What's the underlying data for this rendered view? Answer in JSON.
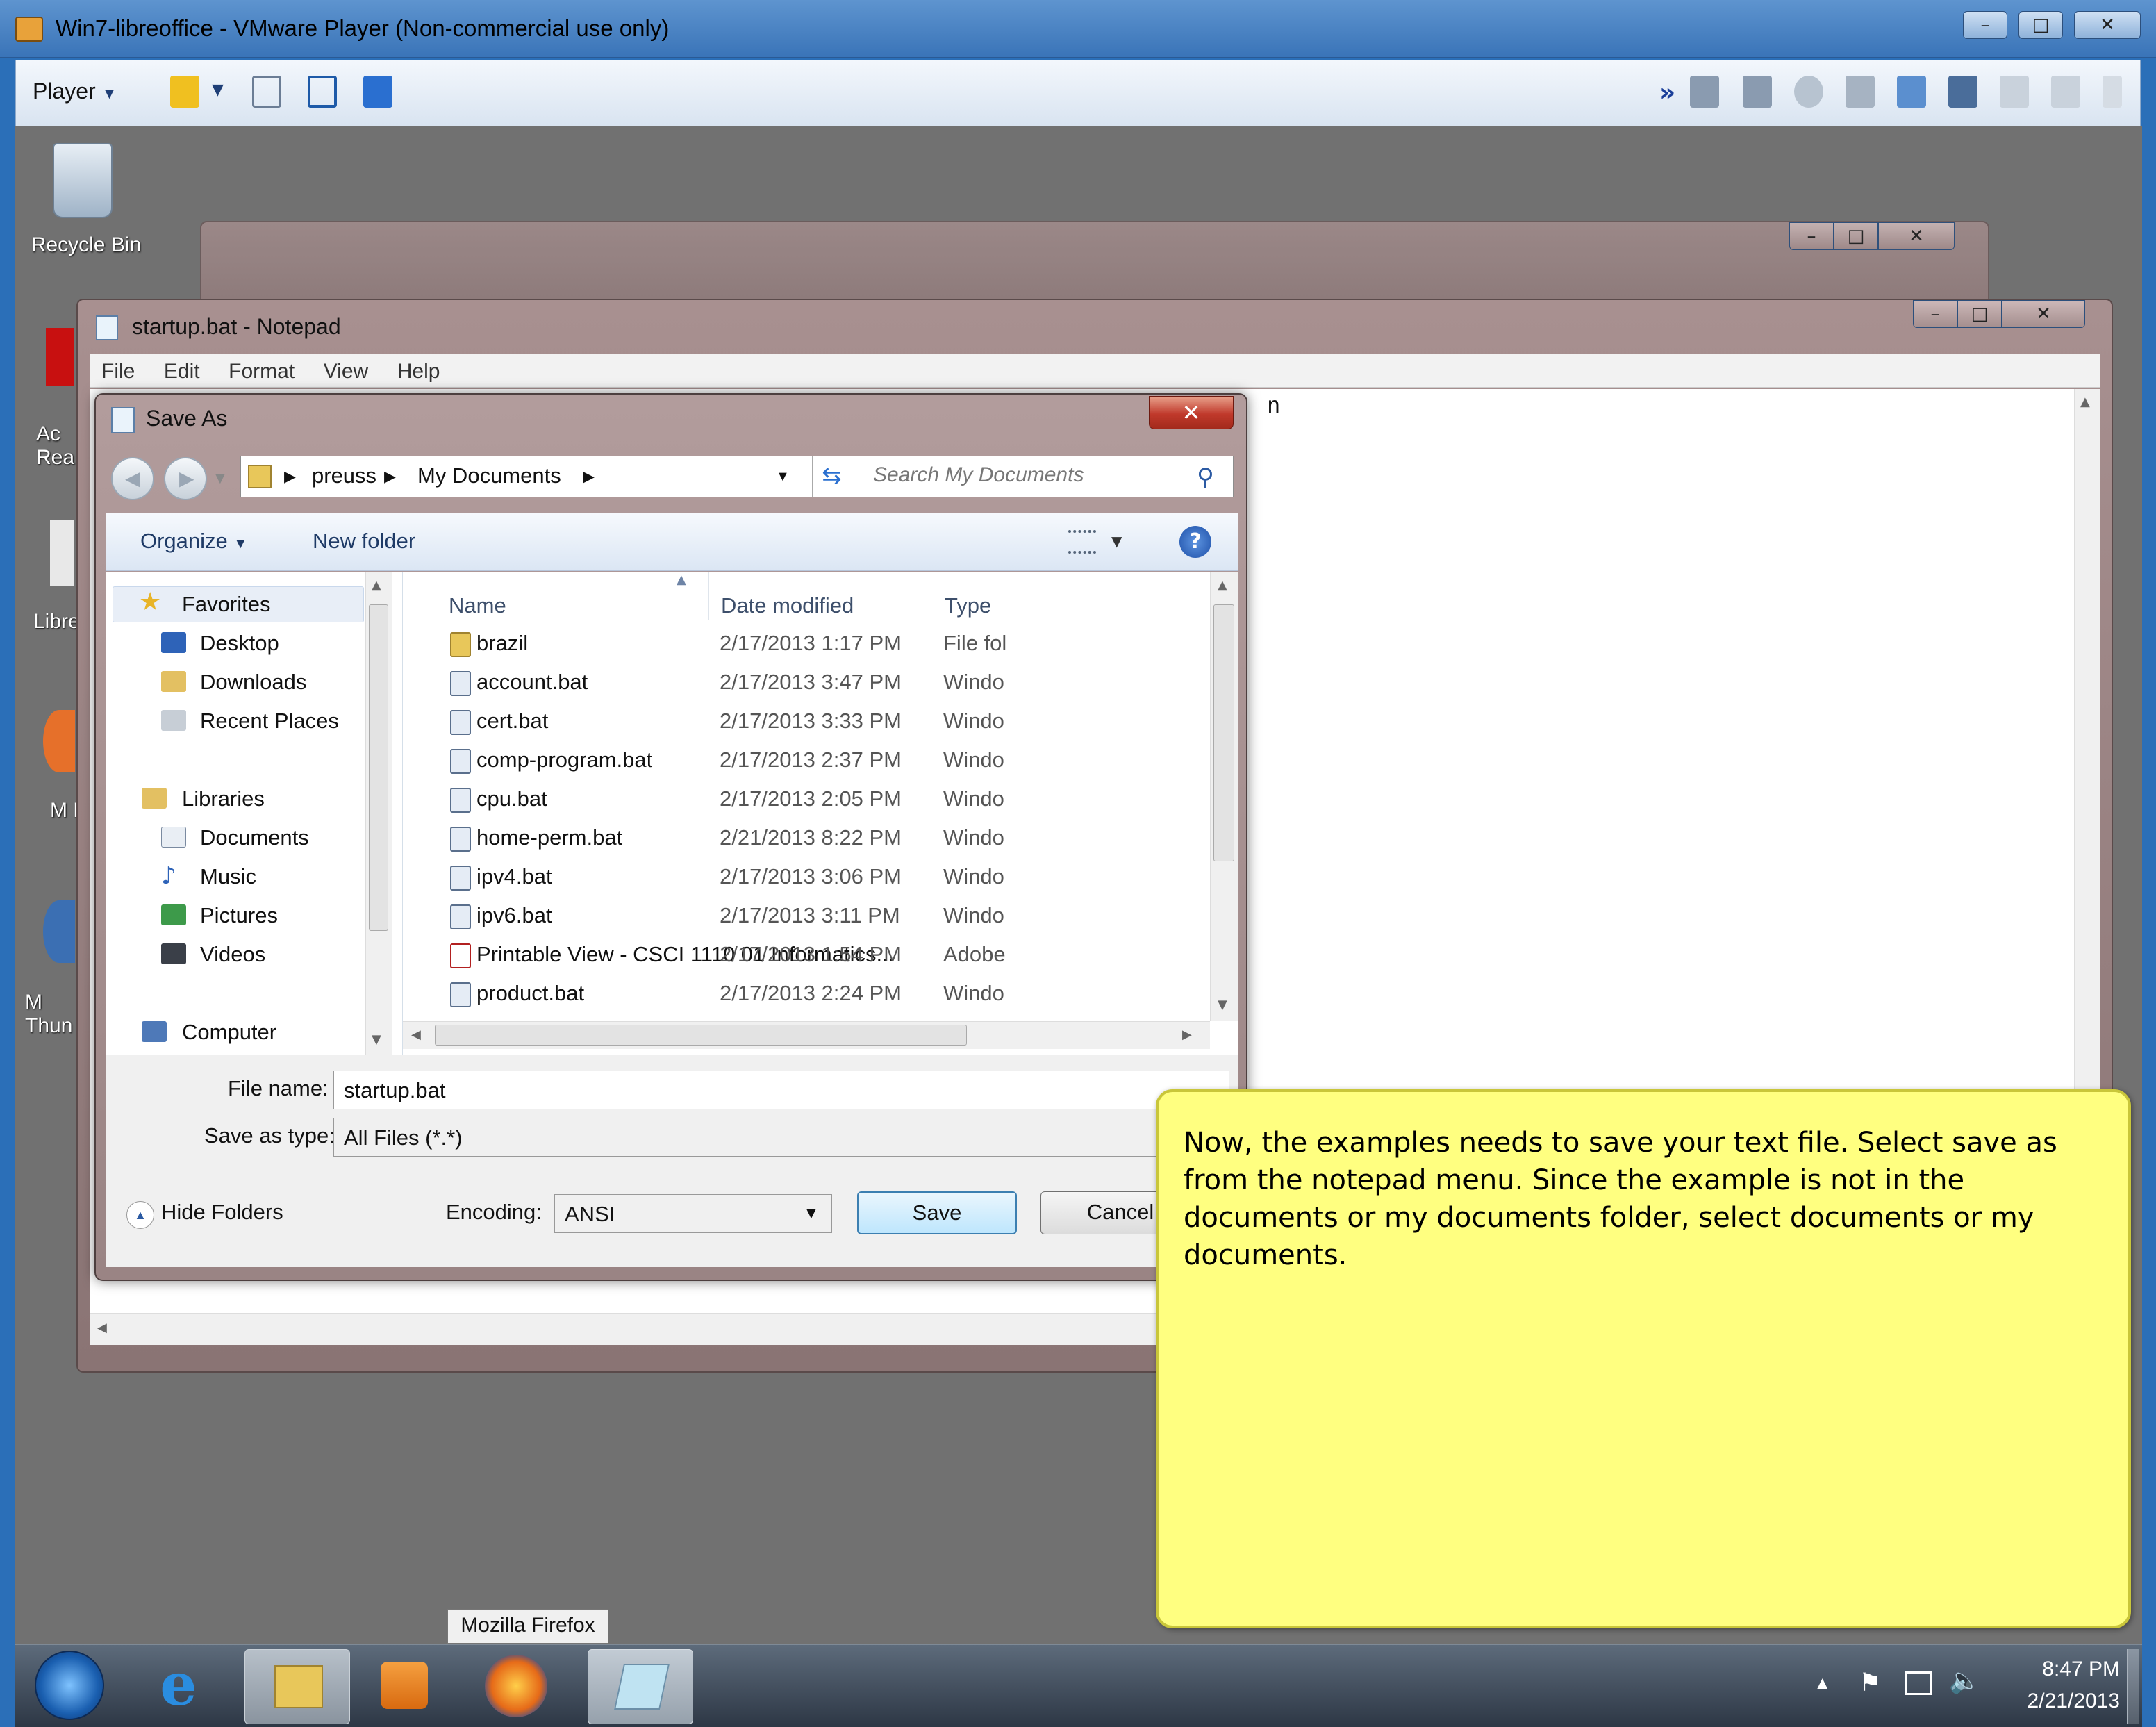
{
  "vm": {
    "title": "Win7-libreoffice - VMware Player (Non-commercial use only)",
    "player_menu": "Player"
  },
  "desktop": {
    "icons": [
      {
        "label": "Recycle Bin",
        "icon": "recycle-bin-icon"
      },
      {
        "label": "Ac Rea",
        "icon": "acrobat-reader-icon"
      },
      {
        "label": "Libre",
        "icon": "libreoffice-icon"
      },
      {
        "label": "M Fi",
        "icon": "firefox-icon"
      },
      {
        "label": "M Thun",
        "icon": "thunderbird-icon"
      }
    ]
  },
  "notepad": {
    "title": "startup.bat - Notepad",
    "menu": [
      "File",
      "Edit",
      "Format",
      "View",
      "Help"
    ],
    "visible_text": "n"
  },
  "saveas": {
    "title": "Save As",
    "breadcrumb": [
      "preuss",
      "My Documents"
    ],
    "search_placeholder": "Search My Documents",
    "organize": "Organize",
    "new_folder": "New folder",
    "nav": {
      "favorites": "Favorites",
      "favorites_items": [
        "Desktop",
        "Downloads",
        "Recent Places"
      ],
      "libraries": "Libraries",
      "libraries_items": [
        "Documents",
        "Music",
        "Pictures",
        "Videos"
      ],
      "computer": "Computer"
    },
    "columns": {
      "name": "Name",
      "date": "Date modified",
      "type": "Type"
    },
    "files": [
      {
        "name": "brazil",
        "date": "2/17/2013 1:17 PM",
        "type": "File fol"
      },
      {
        "name": "account.bat",
        "date": "2/17/2013 3:47 PM",
        "type": "Windo"
      },
      {
        "name": "cert.bat",
        "date": "2/17/2013 3:33 PM",
        "type": "Windo"
      },
      {
        "name": "comp-program.bat",
        "date": "2/17/2013 2:37 PM",
        "type": "Windo"
      },
      {
        "name": "cpu.bat",
        "date": "2/17/2013 2:05 PM",
        "type": "Windo"
      },
      {
        "name": "home-perm.bat",
        "date": "2/21/2013 8:22 PM",
        "type": "Windo"
      },
      {
        "name": "ipv4.bat",
        "date": "2/17/2013 3:06 PM",
        "type": "Windo"
      },
      {
        "name": "ipv6.bat",
        "date": "2/17/2013 3:11 PM",
        "type": "Windo"
      },
      {
        "name": "Printable View - CSCI 1110 01 Informatics...",
        "date": "2/17/2013 1:54 PM",
        "type": "Adobe"
      },
      {
        "name": "product.bat",
        "date": "2/17/2013 2:24 PM",
        "type": "Windo"
      }
    ],
    "file_name_label": "File name:",
    "file_name_value": "startup.bat",
    "save_type_label": "Save as type:",
    "save_type_value": "All Files  (*.*)",
    "hide_folders": "Hide Folders",
    "encoding_label": "Encoding:",
    "encoding_value": "ANSI",
    "save_button": "Save",
    "cancel_button": "Cancel"
  },
  "note": {
    "text": "Now, the examples needs to save your text file. Select save as from the notepad menu. Since the example is not in the documents or my documents folder, select documents or my documents."
  },
  "taskbar": {
    "tooltip": "Mozilla Firefox",
    "time": "8:47 PM",
    "date": "2/21/2013"
  },
  "colors": {
    "vm_titlebar": "#3a74b8",
    "desktop": "#717171",
    "note_bg": "#ffff80",
    "close_red": "#c0392b"
  }
}
